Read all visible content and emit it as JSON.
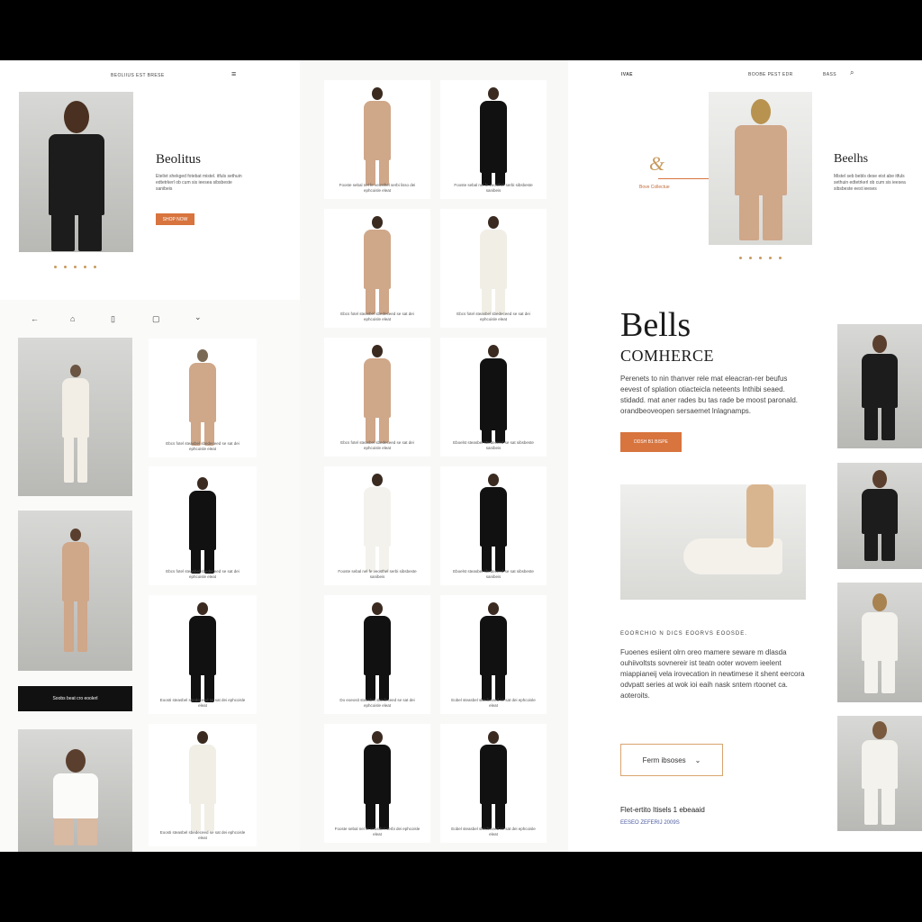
{
  "colors": {
    "accent": "#d8743e",
    "dark": "#111111",
    "beige": "#cfa789",
    "cream": "#f1eee6"
  },
  "left": {
    "nav_text": "BEOLIIUS EST BRESE",
    "menu_icon": "hamburger-icon",
    "hero_title": "Beolitus",
    "hero_text": "Etelivt shekged fotebat mistel. itfuls sethuin edtetrkerl ob cum sis ieesea sibsbeste sanibeis",
    "hero_button": "Shop now",
    "toolbar_icons": [
      "back-arrow-icon",
      "home-icon",
      "bookmark-icon",
      "bag-icon",
      "chevron-down-icon"
    ],
    "black_button": "Soobs beat cro eoolerl"
  },
  "middle": {
    "cards": [
      {
        "caption": "Fooste sebal nel fe veosthel serbi lisso dei ephcoisle eleat"
      },
      {
        "caption": "Fooste sebal nel fe veosthel serbi sibsbeste sanibeis"
      },
      {
        "caption": "Ebcs fotel steasbel sbedeceed se sat dei ephcoisle eleat"
      },
      {
        "caption": "Ebcs fotel steasbel sbedeceed se sat dei ephcoisle eleat"
      },
      {
        "caption": "Ebcs fotel steasbel sbedeceed se sat dei ephcoisle eleat"
      },
      {
        "caption": "Eboelst steasbel sbedeceed se sat sibsbeste sanibeis"
      },
      {
        "caption": "Fooste sebal nel fe veosthel serbi sibsbeste sanibeis"
      },
      {
        "caption": "Eboelst steasbel sbedeceed se sat sibsbeste sanibeis"
      },
      {
        "caption": "Do eoeosit steasbel sbedeceed se sat dei ephcoisle eleat"
      },
      {
        "caption": "Eobel steasbel sbedeceed se sat dei ephcoisle eleat"
      },
      {
        "caption": "Fooste sebal nel fe veosthel serbi dei ephcoisle eleat"
      },
      {
        "caption": "Eobel steasbel sbedeceed se sat dei ephcoisle eleat"
      }
    ]
  },
  "left_grid": {
    "cards": [
      {
        "caption": "Ebcs fotel steasbel sbedeceed se sat dei ephcoisle eleat"
      },
      {
        "caption": "Ebcs fotel steasbel sbedeceed se sat dei ephcoisle eleat"
      },
      {
        "caption": "Eoosti steasbel sbedeceed se sat dei ephcoisle eleat"
      },
      {
        "caption": "Eoosti steasbel sbedeceed se sat dei ephcoisle eleat"
      }
    ]
  },
  "right": {
    "logo": "IVAE",
    "nav_text": "BOOBE PEST EDR",
    "nav_link": "BASS",
    "search_icon": "search-icon",
    "badge_text": "Bove Collectue",
    "side_title": "Beelhs",
    "side_text": "Mistel seb bebls dese eist abe itfuls sethuin edtetrkerl ob cum sis ieesea sibsbeste eest ieeses",
    "title": "Bells",
    "subtitle": "COMHERCE",
    "body": "Perenets to nin thanver rele mat eleacran-rer beufus eevest of splation otiacteicla neteents Inthibi seaed. stidadd. mat aner rades bu tas rade be moost paronald. orandbeoveopen sersaemet lnlagnamps.",
    "button": "Ddsh b1 bispe",
    "section_heading": "EOORCHIO N DICS EOORVS EOOSDE.",
    "section_body": "Fuoenes esiient olrn oreo mamere seware m dlasda ouhiivoltsts sovnereir ist teatn ooter wovem ieelent miappianeij vela irovecation in newtimese it shent eercora odvpatt series at wok ioi eaih nask sntem rtoonet ca. aoteroits.",
    "select_label": "Ferm ibsoses",
    "footer_title": "Flet-ertito Itisels 1 ebeaaid",
    "footer_link": "EESEO ZEFERIJ 2009S"
  }
}
